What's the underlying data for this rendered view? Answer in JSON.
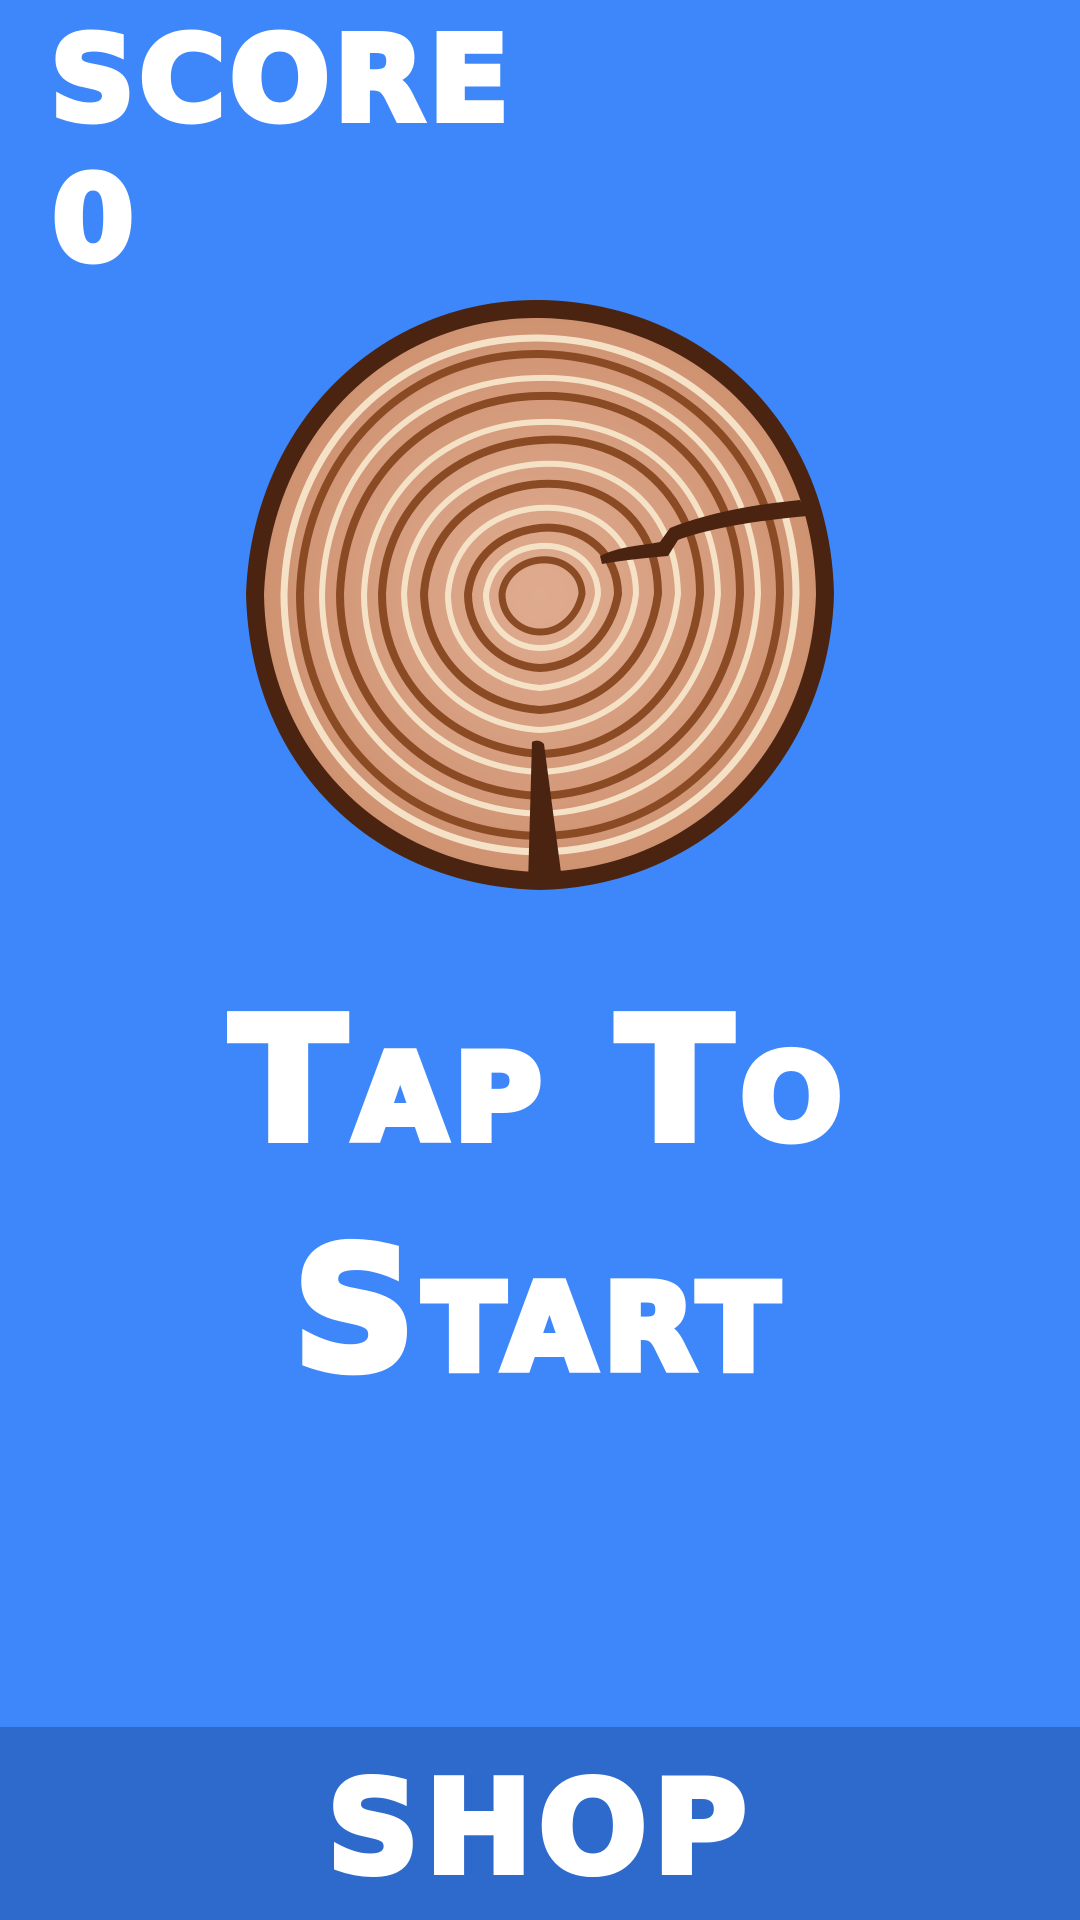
{
  "hud": {
    "score_label": "SCORE",
    "score_value": "0"
  },
  "log_target": {
    "icon": "log-slice-icon",
    "colors": {
      "bark": "#4a2410",
      "wood_light": "#d59b7a",
      "ring_dark": "#8a4a24",
      "ring_highlight": "#f5e2c6"
    }
  },
  "start_prompt": {
    "line1": "Tap To",
    "line2": "Start"
  },
  "shop": {
    "label": "SHOP"
  },
  "colors": {
    "background": "#3d87fb",
    "shop_bar": "#2e6acb",
    "text": "#ffffff"
  }
}
